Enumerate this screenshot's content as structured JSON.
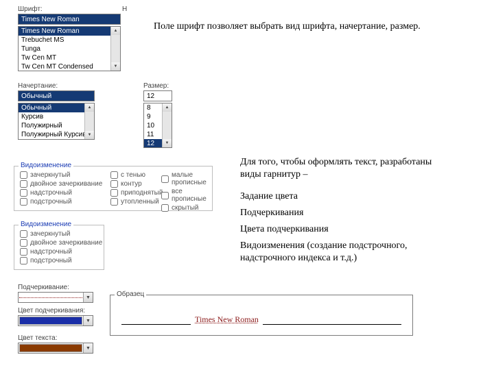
{
  "description_top": "Поле шрифт позволяет выбрать вид шрифта, начертание, размер.",
  "font": {
    "label": "Шрифт:",
    "selected": "Times New Roman",
    "options": [
      "Times New Roman",
      "Trebuchet MS",
      "Tunga",
      "Tw Cen MT",
      "Tw Cen MT Condensed"
    ]
  },
  "style": {
    "label": "Начертание:",
    "selected": "Обычный",
    "options": [
      "Обычный",
      "Курсив",
      "Полужирный",
      "Полужирный Курсив"
    ]
  },
  "size": {
    "label": "Размер:",
    "selected": "12",
    "options": [
      "8",
      "9",
      "10",
      "11",
      "12"
    ]
  },
  "effects1": {
    "title": "Видоизменение",
    "col1": [
      "зачеркнутый",
      "двойное зачеркивание",
      "надстрочный",
      "подстрочный"
    ],
    "col2": [
      "с тенью",
      "контур",
      "приподнятый",
      "утопленный"
    ],
    "col3": [
      "малые прописные",
      "все прописные",
      "скрытый"
    ]
  },
  "effects2": {
    "title": "Видоизменение",
    "items": [
      "зачеркнутый",
      "двойное зачеркивание",
      "надстрочный",
      "подстрочный"
    ]
  },
  "right_list": [
    "Для того, чтобы оформлять текст, разработаны виды гарнитур –",
    "Задание цвета",
    "Подчеркивания",
    "Цвета подчеркивания",
    "Видоизменения (создание подстрочного, надстрочного индекса и т.д.)"
  ],
  "underline": {
    "label": "Подчеркивание:",
    "underline_color_label": "Цвет подчеркивания:",
    "text_color_label": "Цвет текста:"
  },
  "preview": {
    "title": "Образец",
    "text": "Times New Roman"
  },
  "colors": {
    "underline_swatch": "#1a2ea8",
    "text_swatch": "#8a3a00"
  }
}
